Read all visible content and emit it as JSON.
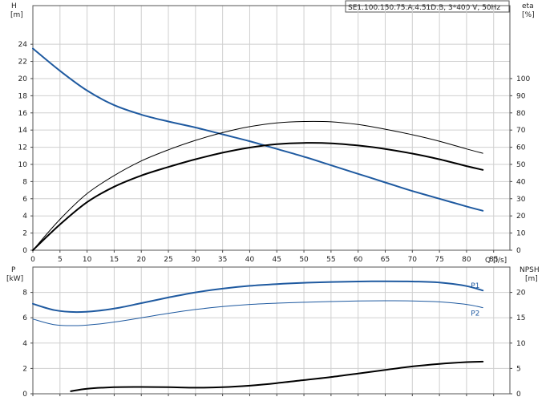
{
  "chart_data": [
    {
      "type": "line",
      "title": "SE1.100.150.75.A.4.51D.B, 3*400 V, 50Hz",
      "xlabel": "Q [l/s]",
      "ylabel_left": "H",
      "ylabel_left_unit": "[m]",
      "ylabel_right": "eta",
      "ylabel_right_unit": "[%]",
      "xlim": [
        0,
        88
      ],
      "ylim_left": [
        0,
        28.5
      ],
      "ylim_right": [
        0,
        142.5
      ],
      "x_ticks": [
        0,
        5,
        10,
        15,
        20,
        25,
        30,
        35,
        40,
        45,
        50,
        55,
        60,
        65,
        70,
        75,
        80,
        85
      ],
      "y_ticks_left": [
        0,
        2,
        4,
        6,
        8,
        10,
        12,
        14,
        16,
        18,
        20,
        22,
        24
      ],
      "y_ticks_right": [
        0,
        10,
        20,
        30,
        40,
        50,
        60,
        70,
        80,
        90,
        100
      ],
      "grid": true,
      "series": [
        {
          "axis": "left",
          "color": "#1f5aa0",
          "width": 2,
          "x": [
            0,
            5,
            10,
            15,
            20,
            25,
            30,
            35,
            40,
            45,
            50,
            55,
            60,
            65,
            70,
            75,
            80,
            83
          ],
          "y": [
            23.5,
            20.9,
            18.6,
            16.9,
            15.8,
            15.0,
            14.3,
            13.5,
            12.7,
            11.8,
            10.9,
            9.9,
            8.9,
            7.9,
            6.9,
            6.0,
            5.1,
            4.6
          ]
        },
        {
          "axis": "right",
          "color": "#000000",
          "width": 2,
          "x": [
            0,
            5,
            10,
            15,
            20,
            25,
            30,
            35,
            40,
            45,
            50,
            55,
            60,
            65,
            70,
            75,
            80,
            83
          ],
          "y": [
            0,
            15,
            28,
            37,
            43.5,
            48.5,
            53,
            56.8,
            59.8,
            61.8,
            62.5,
            62.3,
            61,
            59,
            56.3,
            53,
            49,
            46.8
          ]
        },
        {
          "axis": "right",
          "color": "#000000",
          "width": 1,
          "x": [
            0,
            5,
            10,
            15,
            20,
            25,
            30,
            35,
            40,
            45,
            50,
            55,
            60,
            65,
            70,
            75,
            80,
            83
          ],
          "y": [
            0,
            18,
            33,
            43.5,
            52,
            58.5,
            64,
            68.5,
            72,
            74.2,
            75,
            74.8,
            73.2,
            70.5,
            67.3,
            63.5,
            59,
            56.5
          ]
        }
      ]
    },
    {
      "type": "line",
      "ylabel_left": "P",
      "ylabel_left_unit": "[kW]",
      "ylabel_right": "NPSH",
      "ylabel_right_unit": "[m]",
      "xlim": [
        0,
        88
      ],
      "ylim_left": [
        0,
        10
      ],
      "ylim_right": [
        0,
        25
      ],
      "x_ticks": [
        0,
        5,
        10,
        15,
        20,
        25,
        30,
        35,
        40,
        45,
        50,
        55,
        60,
        65,
        70,
        75,
        80,
        85
      ],
      "y_ticks_left": [
        0,
        2,
        4,
        6,
        8
      ],
      "y_ticks_right": [
        0,
        5,
        10,
        15,
        20
      ],
      "grid": true,
      "series": [
        {
          "name": "P1",
          "axis": "left",
          "color": "#1f5aa0",
          "width": 2,
          "x": [
            0,
            4,
            8,
            12,
            16,
            20,
            25,
            30,
            35,
            40,
            45,
            50,
            55,
            60,
            65,
            70,
            75,
            80,
            83
          ],
          "y": [
            7.1,
            6.6,
            6.45,
            6.55,
            6.8,
            7.15,
            7.6,
            8.0,
            8.3,
            8.52,
            8.66,
            8.76,
            8.82,
            8.86,
            8.88,
            8.86,
            8.78,
            8.5,
            8.15
          ]
        },
        {
          "name": "P2",
          "axis": "left",
          "color": "#1f5aa0",
          "width": 1,
          "x": [
            0,
            4,
            8,
            12,
            16,
            20,
            25,
            30,
            35,
            40,
            45,
            50,
            55,
            60,
            65,
            70,
            75,
            80,
            83
          ],
          "y": [
            5.9,
            5.45,
            5.38,
            5.5,
            5.72,
            6.0,
            6.35,
            6.65,
            6.88,
            7.05,
            7.15,
            7.22,
            7.28,
            7.32,
            7.34,
            7.33,
            7.25,
            7.05,
            6.8
          ]
        },
        {
          "axis": "right",
          "color": "#000000",
          "width": 2,
          "x": [
            7,
            10,
            15,
            20,
            25,
            30,
            35,
            40,
            45,
            50,
            55,
            60,
            65,
            70,
            75,
            80,
            83
          ],
          "y": [
            0.5,
            1.0,
            1.3,
            1.35,
            1.3,
            1.2,
            1.3,
            1.6,
            2.1,
            2.7,
            3.3,
            4.0,
            4.7,
            5.4,
            5.9,
            6.25,
            6.35
          ]
        }
      ]
    }
  ]
}
